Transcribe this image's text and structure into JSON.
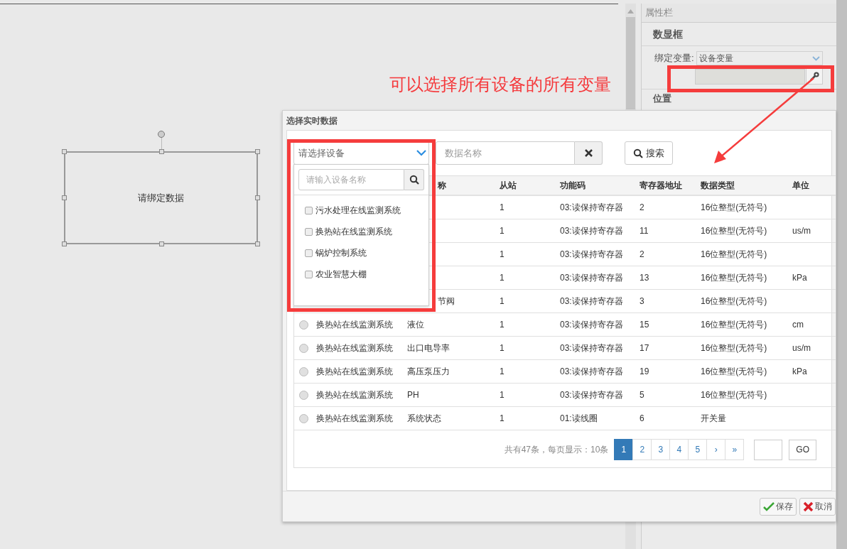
{
  "canvas": {
    "widget_label": "请绑定数据"
  },
  "properties": {
    "title": "属性栏",
    "section": "数显框",
    "bind_label": "绑定变量:",
    "bind_value": "设备变量",
    "position_label": "位置"
  },
  "annotation": {
    "text": "可以选择所有设备的所有变量"
  },
  "dialog": {
    "title": "选择实时数据",
    "device_select": {
      "placeholder": "请选择设备"
    },
    "device_dropdown": {
      "search_placeholder": "请输入设备名称",
      "items": [
        {
          "label": "污水处理在线监测系统",
          "checked": false
        },
        {
          "label": "换热站在线监测系统",
          "checked": false
        },
        {
          "label": "锅炉控制系统",
          "checked": false
        },
        {
          "label": "农业智慧大棚",
          "checked": false
        }
      ]
    },
    "name_field": {
      "placeholder": "数据名称"
    },
    "search_button": "搜索",
    "table": {
      "columns": [
        "称",
        "从站",
        "功能码",
        "寄存器地址",
        "数据类型",
        "单位"
      ],
      "rows": [
        {
          "slave": "1",
          "function": "03:读保持寄存器",
          "address": "2",
          "type": "16位整型(无符号)"
        },
        {
          "slave": "1",
          "function": "03:读保持寄存器",
          "address": "11",
          "type": "16位整型(无符号)",
          "unit": "us/m"
        },
        {
          "slave": "1",
          "function": "03:读保持寄存器",
          "address": "2",
          "type": "16位整型(无符号)"
        },
        {
          "slave": "1",
          "function": "03:读保持寄存器",
          "address": "13",
          "type": "16位整型(无符号)",
          "unit": "kPa"
        },
        {
          "name": "节阀",
          "slave": "1",
          "function": "03:读保持寄存器",
          "address": "3",
          "type": "16位整型(无符号)"
        },
        {
          "selected": false,
          "device": "换热站在线监测系统",
          "name": "液位",
          "slave": "1",
          "function": "03:读保持寄存器",
          "address": "15",
          "type": "16位整型(无符号)",
          "unit": "cm"
        },
        {
          "selected": false,
          "device": "换热站在线监测系统",
          "name": "出口电导率",
          "slave": "1",
          "function": "03:读保持寄存器",
          "address": "17",
          "type": "16位整型(无符号)",
          "unit": "us/m"
        },
        {
          "selected": false,
          "device": "换热站在线监测系统",
          "name": "高压泵压力",
          "slave": "1",
          "function": "03:读保持寄存器",
          "address": "19",
          "type": "16位整型(无符号)",
          "unit": "kPa"
        },
        {
          "selected": false,
          "device": "换热站在线监测系统",
          "name": "PH",
          "slave": "1",
          "function": "03:读保持寄存器",
          "address": "5",
          "type": "16位整型(无符号)"
        },
        {
          "selected": false,
          "device": "换热站在线监测系统",
          "name": "系统状态",
          "slave": "1",
          "function": "01:读线圈",
          "address": "6",
          "type": "开关量"
        }
      ]
    },
    "pagination": {
      "summary": "共有47条，每页显示：10条",
      "pages": [
        {
          "label": "1",
          "selected": true
        },
        {
          "label": "2",
          "selected": false
        },
        {
          "label": "3",
          "selected": false
        },
        {
          "label": "4",
          "selected": false
        },
        {
          "label": "5",
          "selected": false
        },
        {
          "label": "›",
          "selected": false
        },
        {
          "label": "»",
          "selected": false
        }
      ],
      "go_button": "GO"
    },
    "buttons": [
      {
        "kind": "save",
        "label": "保存"
      },
      {
        "kind": "cancel",
        "label": "取消"
      }
    ]
  }
}
